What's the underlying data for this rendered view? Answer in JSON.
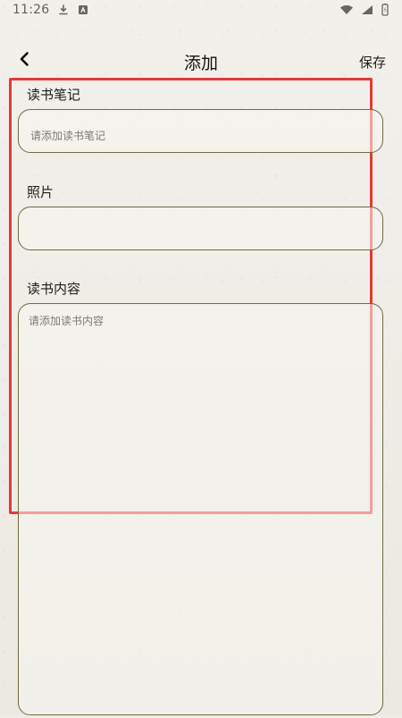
{
  "status_bar": {
    "time": "11:26",
    "icons": [
      "download-icon",
      "a-icon",
      "wifi-icon",
      "signal-icon",
      "battery-icon"
    ]
  },
  "header": {
    "title": "添加",
    "back_icon": "chevron-left-icon",
    "save_label": "保存"
  },
  "form": {
    "reading_notes_label": "读书笔记",
    "reading_notes_placeholder": "请添加读书笔记",
    "photo_label": "照片",
    "reading_content_label": "读书内容",
    "reading_content_placeholder": "请添加读书内容"
  },
  "colors": {
    "background": "#efede7",
    "field_border": "#6f6a42",
    "highlight": "#e53935"
  }
}
